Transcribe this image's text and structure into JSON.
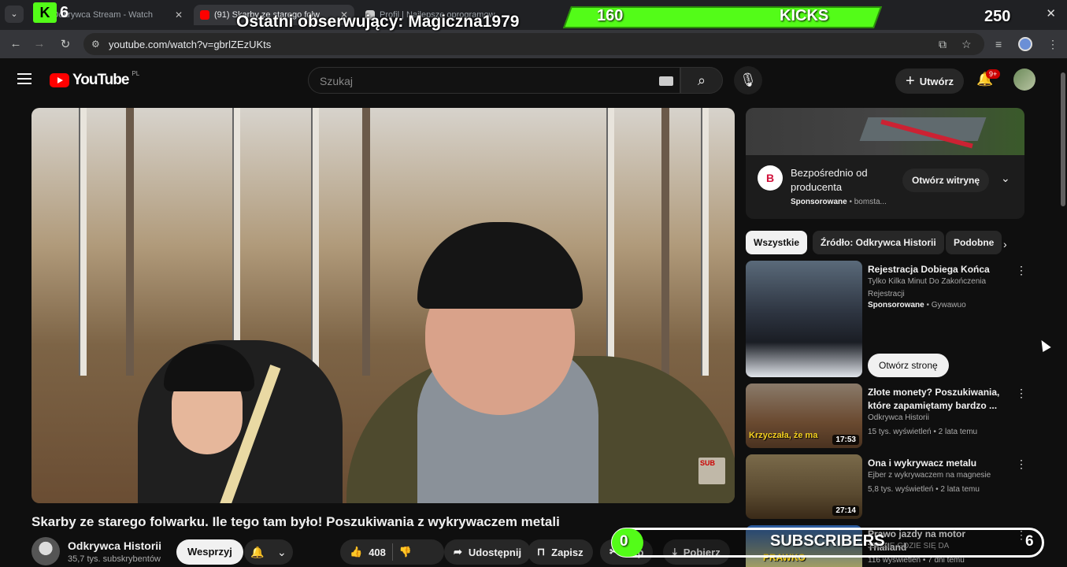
{
  "browser": {
    "tabs": [
      {
        "title": "Odkrywca Stream - Watch",
        "fav_color": "#53fc18",
        "active": false
      },
      {
        "title": "(91) Skarby ze starego folw",
        "fav_color": "#ff0000",
        "active": true
      },
      {
        "title": "Profil | Najlepsze oprogramow",
        "fav_color": "#cccccc",
        "active": false
      }
    ],
    "url": "youtube.com/watch?v=gbrlZEzUKts",
    "icons": [
      "back-icon",
      "forward-icon",
      "reload-icon",
      "site-info-icon",
      "install-icon",
      "bookmark-star-icon",
      "media-icon",
      "profile-icon",
      "menu-icon"
    ]
  },
  "youtube": {
    "logo_text": "YouTube",
    "country": "PL",
    "search_placeholder": "Szukaj",
    "create_label": "Utwórz",
    "notifications_badge": "9+"
  },
  "video": {
    "title": "Skarby ze starego folwarku. Ile tego tam było! Poszukiwania z wykrywaczem metali",
    "channel": "Odkrywca Historii",
    "subscribers": "35,7 tys. subskrybentów",
    "join_label": "Wesprzyj",
    "likes": "408",
    "share_label": "Udostępnij",
    "save_label": "Zapisz",
    "clip_label": "Klip",
    "download_label": "Pobierz",
    "sub_watermark": "SUB"
  },
  "ad": {
    "title": "Bezpośrednio od producenta",
    "sponsored": "Sponsorowane",
    "advertiser": "bomsta...",
    "open_label": "Otwórz witrynę",
    "logo_letter": "B"
  },
  "chips": [
    "Wszystkie",
    "Źródło: Odkrywca Historii",
    "Podobne"
  ],
  "recommendations": [
    {
      "title": "Rejestracja Dobiega Końca",
      "line1": "Tylko Kilka Minut Do Zakończenia Rejestracji",
      "line2_bold": "Sponsorowane",
      "line2": "Gywawuo",
      "open_label": "Otwórz stronę",
      "duration": "",
      "thumb_text": ""
    },
    {
      "title": "Złote monety? Poszukiwania, które zapamiętamy bardzo ...",
      "line1": "Odkrywca Historii",
      "line2": "15 tys. wyświetleń • 2 lata temu",
      "duration": "17:53",
      "thumb_text": "Krzyczała, że ma"
    },
    {
      "title": "Ona i wykrywacz metalu",
      "line1": "Ejber z wykrywaczem na magnesie",
      "line2": "5,8 tys. wyświetleń • 2 lata temu",
      "duration": "27:14",
      "thumb_text": ""
    },
    {
      "title": "Prawo jazdy na motor Thailand",
      "line1": "JEDZIE GDZIE SIĘ DA",
      "line2": "116 wyświetleń • 7 dni temu",
      "duration": "",
      "thumb_text": "PRAWKO"
    }
  ],
  "overlays": {
    "kick_count": "6",
    "last_follower": "Ostatni obserwujący: Magiczna1979",
    "kicks_current": "160",
    "kicks_label": "KICKS",
    "kicks_goal": "250",
    "subs_current": "0",
    "subs_label": "SUBSCRIBERS",
    "subs_goal": "6"
  },
  "colors": {
    "background": "#0f0f0f",
    "yt_red": "#ff0000",
    "kick_green": "#53fc18"
  }
}
